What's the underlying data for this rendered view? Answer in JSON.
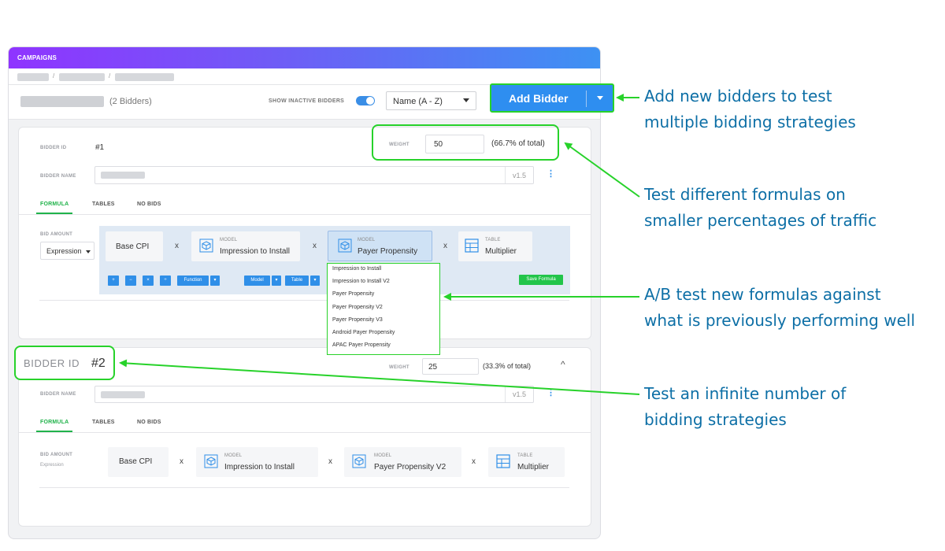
{
  "app": {
    "topbar_title": "CAMPAIGNS",
    "breadcrumb_separator": "/"
  },
  "header": {
    "bidder_count": "(2 Bidders)",
    "show_inactive_label": "SHOW INACTIVE BIDDERS",
    "show_inactive_on": true,
    "sort_value": "Name (A - Z)",
    "add_bidder_label": "Add Bidder"
  },
  "bidder1": {
    "id_label": "BIDDER ID",
    "id_value": "#1",
    "name_label": "BIDDER NAME",
    "version": "v1.5",
    "weight_label": "WEIGHT",
    "weight_value": "50",
    "weight_pct": "(66.7% of total)",
    "tabs": [
      "FORMULA",
      "TABLES",
      "NO BIDS"
    ],
    "bid_amount_label": "BID AMOUNT",
    "bid_amount_mode": "Expression",
    "formula": {
      "base": "Base CPI",
      "times": "x",
      "term1_type": "MODEL",
      "term1_value": "Impression to Install",
      "term2_type": "MODEL",
      "term2_value": "Payer Propensity",
      "term3_type": "TABLE",
      "term3_value": "Multiplier"
    },
    "toolbar": {
      "plus": "+",
      "minus": "−",
      "times": "×",
      "divide": "÷",
      "function": "Function",
      "model": "Model",
      "table": "Table",
      "save": "Save Formula"
    },
    "model_options": [
      "Impression to Install",
      "Impression to Install V2",
      "Payer Propensity",
      "Payer Propensity V2",
      "Payer Propensity V3",
      "Android Payer Propensity",
      "APAC Payer Propensity"
    ]
  },
  "bidder2": {
    "id_label": "BIDDER ID",
    "id_value": "#2",
    "name_label": "BIDDER NAME",
    "version": "v1.5",
    "weight_label": "WEIGHT",
    "weight_value": "25",
    "weight_pct": "(33.3% of total)",
    "tabs": [
      "FORMULA",
      "TABLES",
      "NO BIDS"
    ],
    "bid_amount_label": "BID AMOUNT",
    "bid_amount_mode": "Expression",
    "formula": {
      "base": "Base CPI",
      "times": "x",
      "term1_type": "MODEL",
      "term1_value": "Impression to Install",
      "term2_type": "MODEL",
      "term2_value": "Payer Propensity V2",
      "term3_type": "TABLE",
      "term3_value": "Multiplier"
    }
  },
  "annotations": {
    "a1_line1": "Add new bidders to test",
    "a1_line2": "multiple bidding strategies",
    "a2_line1": "Test different formulas on",
    "a2_line2": "smaller percentages of traffic",
    "a3_line1": "A/B test new formulas against",
    "a3_line2": "what is previously performing well",
    "a4_line1": "Test an infinite number of",
    "a4_line2": "bidding strategies"
  },
  "colors": {
    "annotation_text": "#0d6fa6",
    "callout_green": "#27d22a",
    "primary_blue": "#2e8ef0",
    "tab_active_green": "#21b34b"
  }
}
